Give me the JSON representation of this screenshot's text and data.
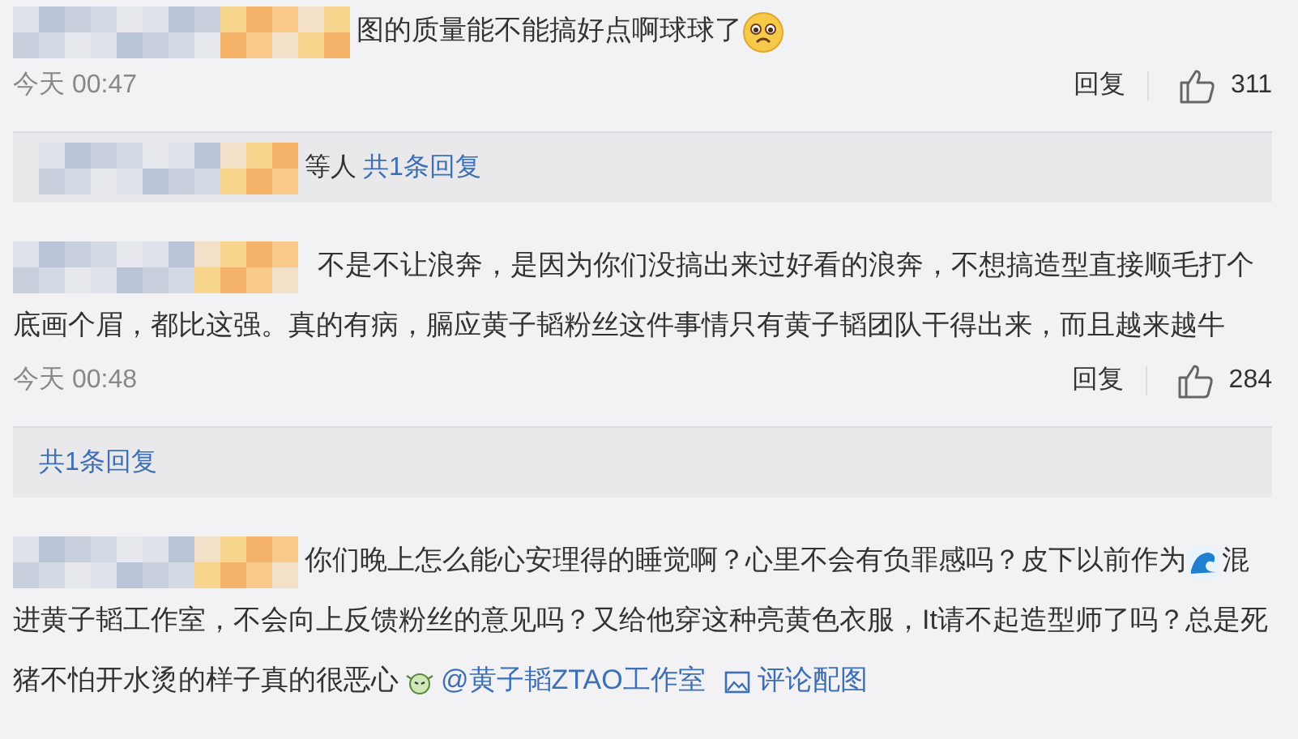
{
  "comments": [
    {
      "parts": [
        {
          "kind": "text",
          "text": "图的质量能不能搞好点啊球球了"
        },
        {
          "kind": "cry"
        }
      ],
      "time": "今天 00:47",
      "reply_action": "回复",
      "likes": "311",
      "replies": {
        "suffix": "等人",
        "link": "共1条回复"
      }
    },
    {
      "parts": [
        {
          "kind": "text",
          "text": "不是不让浪奔，是因为你们没搞出来过好看的浪奔，不想搞造型直接顺毛打个底画个眉，都比这强。真的有病，膈应黄子韬粉丝这件事情只有黄子韬团队干得出来，而且越来越牛"
        }
      ],
      "time": "今天 00:48",
      "reply_action": "回复",
      "likes": "284",
      "replies": {
        "link": "共1条回复"
      }
    },
    {
      "parts": [
        {
          "kind": "text",
          "text": "你们晚上怎么能心安理得的睡觉啊？心里不会有负罪感吗？皮下以前作为"
        },
        {
          "kind": "wave"
        },
        {
          "kind": "text",
          "text": "混进黄子韬工作室，不会向上反馈粉丝的意见吗？又给他穿这种亮黄色衣服，It请不起造型师了吗？总是死猪不怕开水烫的样子真的很恶心"
        },
        {
          "kind": "smirk"
        },
        {
          "kind": "mention",
          "text": "@黄子韬ZTAO工作室"
        },
        {
          "kind": "photo",
          "text": "评论配图"
        }
      ]
    }
  ]
}
